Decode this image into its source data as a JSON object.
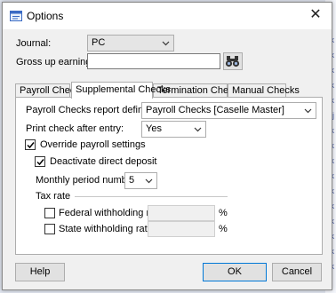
{
  "window": {
    "title": "Options",
    "close_glyph": "✕"
  },
  "journal": {
    "label": "Journal:",
    "value": "PC"
  },
  "gross_up": {
    "label": "Gross up earnings:",
    "value": ""
  },
  "tabs": [
    {
      "label": "Payroll Checks"
    },
    {
      "label": "Supplemental Checks"
    },
    {
      "label": "Termination Checks"
    },
    {
      "label": "Manual Checks"
    }
  ],
  "active_tab": "Supplemental Checks",
  "supplemental": {
    "report_definition": {
      "label": "Payroll Checks report definition:",
      "value": "Payroll Checks [Caselle Master]"
    },
    "print_after_entry": {
      "label": "Print check after entry:",
      "value": "Yes"
    },
    "override_payroll": {
      "label": "Override payroll settings",
      "checked": true
    },
    "deactivate_dd": {
      "label": "Deactivate direct deposit",
      "checked": true
    },
    "monthly_period": {
      "label": "Monthly period number:",
      "value": "5"
    },
    "tax_rate": {
      "heading": "Tax rate",
      "federal": {
        "label": "Federal withholding rate:",
        "value": "",
        "unit": "%",
        "checked": false
      },
      "state": {
        "label": "State withholding rate:",
        "value": "",
        "unit": "%",
        "checked": false
      }
    }
  },
  "buttons": {
    "help": "Help",
    "ok": "OK",
    "cancel": "Cancel"
  },
  "background_glyphs": [
    "ck",
    "k",
    "ck",
    "k",
    "ck",
    "dj",
    "k",
    "ck",
    "ck",
    "k",
    "ck",
    "ck",
    "k",
    "ck",
    "k",
    "ck"
  ],
  "colors": {
    "dialog_bg": "#f0f0f0",
    "accent": "#0078d7",
    "background_link": "#4a5ea8"
  }
}
